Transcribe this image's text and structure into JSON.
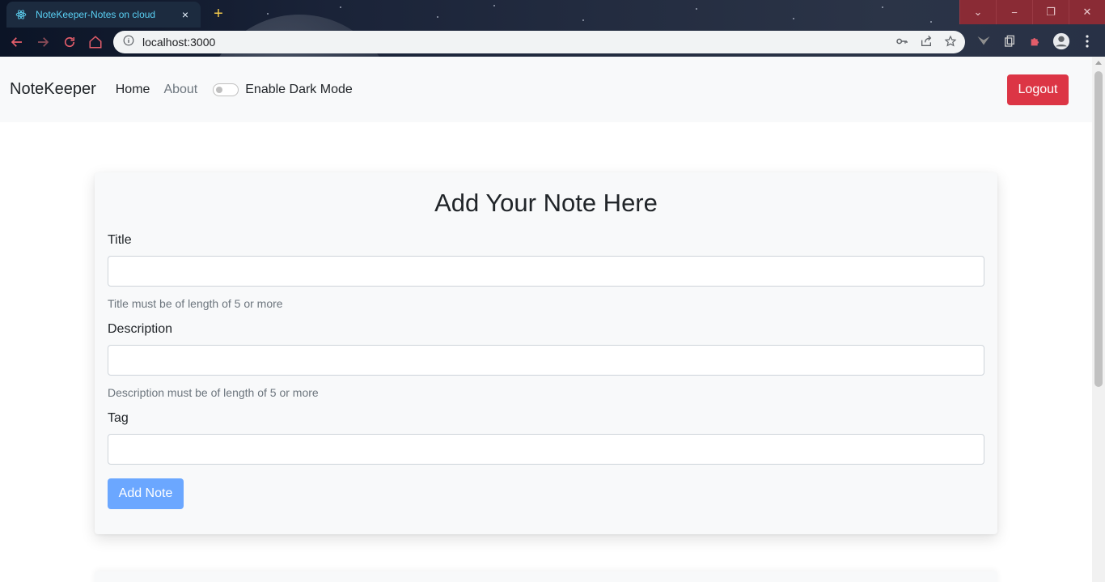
{
  "browser": {
    "tab_title": "NoteKeeper-Notes on cloud",
    "url": "localhost:3000",
    "new_tab_symbol": "+",
    "close_symbol": "×"
  },
  "navbar": {
    "brand": "NoteKeeper",
    "links": [
      "Home",
      "About"
    ],
    "dark_mode_label": "Enable Dark Mode",
    "dark_mode_enabled": false,
    "logout_label": "Logout"
  },
  "form": {
    "heading": "Add Your Note Here",
    "fields": [
      {
        "label": "Title",
        "value": "",
        "help": "Title must be of length of 5 or more"
      },
      {
        "label": "Description",
        "value": "",
        "help": "Description must be of length of 5 or more"
      },
      {
        "label": "Tag",
        "value": "",
        "help": ""
      }
    ],
    "submit_label": "Add Note"
  },
  "colors": {
    "logout_bg": "#dc3545",
    "submit_bg": "#6ba7ff",
    "navbar_bg": "#f8f9fa",
    "tab_text": "#5ad1f5"
  }
}
